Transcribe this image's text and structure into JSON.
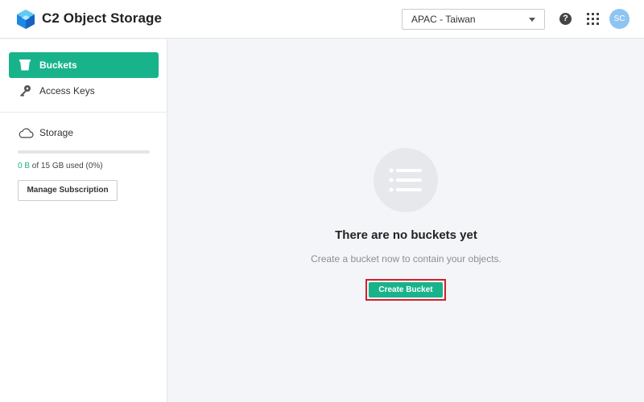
{
  "header": {
    "app_title": "C2 Object Storage",
    "region": "APAC - Taiwan",
    "help_symbol": "?",
    "avatar_initials": "SC"
  },
  "sidebar": {
    "items": [
      {
        "label": "Buckets",
        "icon": "bucket-icon",
        "active": true
      },
      {
        "label": "Access Keys",
        "icon": "key-icon",
        "active": false
      }
    ],
    "storage": {
      "label": "Storage",
      "icon": "cloud-icon",
      "used": "0 B",
      "usage_rest": " of 15 GB used (0%)",
      "percent": 0,
      "manage_label": "Manage Subscription"
    }
  },
  "main": {
    "empty_icon": "list-icon",
    "empty_title": "There are no buckets yet",
    "empty_subtitle": "Create a bucket now to contain your objects.",
    "create_label": "Create Bucket"
  },
  "colors": {
    "accent": "#18b38a",
    "highlight_border": "#d0202a"
  }
}
